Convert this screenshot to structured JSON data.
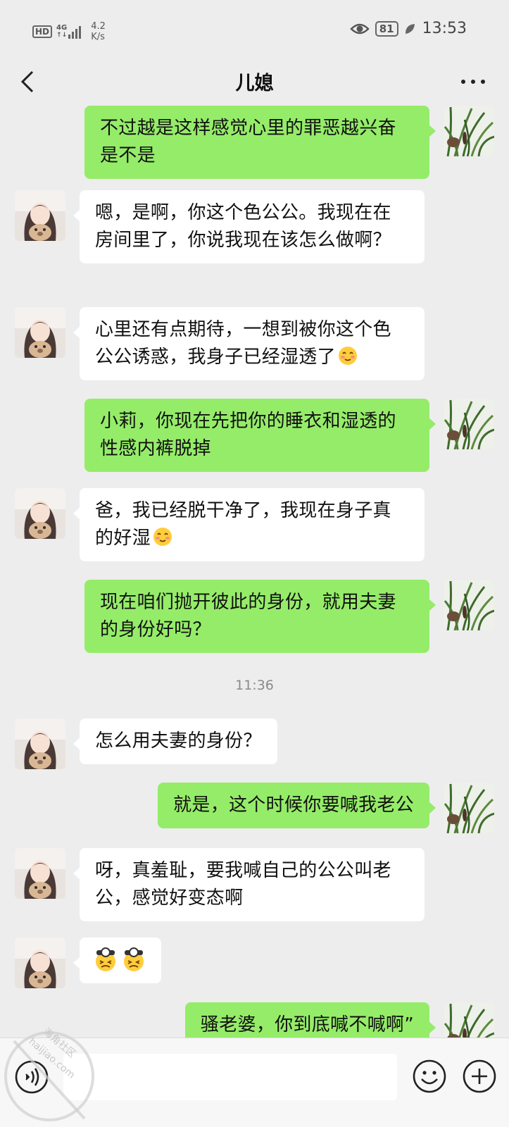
{
  "status_bar": {
    "hd": "HD",
    "network": "4G",
    "speed_value": "4.2",
    "speed_unit": "K/s",
    "battery": "81",
    "time": "13:53"
  },
  "header": {
    "title": "儿媳",
    "back_icon": "chevron-left-icon",
    "more_icon": "more-horizontal-icon"
  },
  "messages": [
    {
      "side": "right",
      "text": "不过越是这样感觉心里的罪恶越兴奋是不是"
    },
    {
      "side": "left",
      "text": "嗯，是啊，你这个色公公。我现在在房间里了，你说我现在该怎么做啊？"
    },
    {
      "side": "left",
      "text": "心里还有点期待，一想到被你这个色公公诱惑，我身子已经湿透了",
      "emoji": "blush-emoji"
    },
    {
      "side": "right",
      "text": "小莉，你现在先把你的睡衣和湿透的性感内裤脱掉"
    },
    {
      "side": "left",
      "text": "爸，我已经脱干净了，我现在身子真的好湿",
      "emoji": "blush-emoji"
    },
    {
      "side": "right",
      "text": "现在咱们抛开彼此的身份，就用夫妻的身份好吗？"
    },
    {
      "type": "time",
      "text": "11:36"
    },
    {
      "side": "left",
      "text": "怎么用夫妻的身份？"
    },
    {
      "side": "right",
      "text": "就是，这个时候你要喊我老公"
    },
    {
      "side": "left",
      "text": "呀，真羞耻，要我喊自己的公公叫老公，感觉好变态啊"
    },
    {
      "side": "left",
      "text": "",
      "emoji": "headlamp-emoji"
    },
    {
      "side": "right",
      "text": "骚老婆，你到底喊不喊啊”"
    }
  ],
  "watermark": {
    "line1": "海角社区",
    "line2": "haijiao.com"
  },
  "input_bar": {
    "voice_icon": "voice-icon",
    "emoji_icon": "smile-icon",
    "plus_icon": "plus-icon"
  },
  "colors": {
    "background": "#ededed",
    "self_bubble": "#95ec69",
    "other_bubble": "#ffffff"
  }
}
